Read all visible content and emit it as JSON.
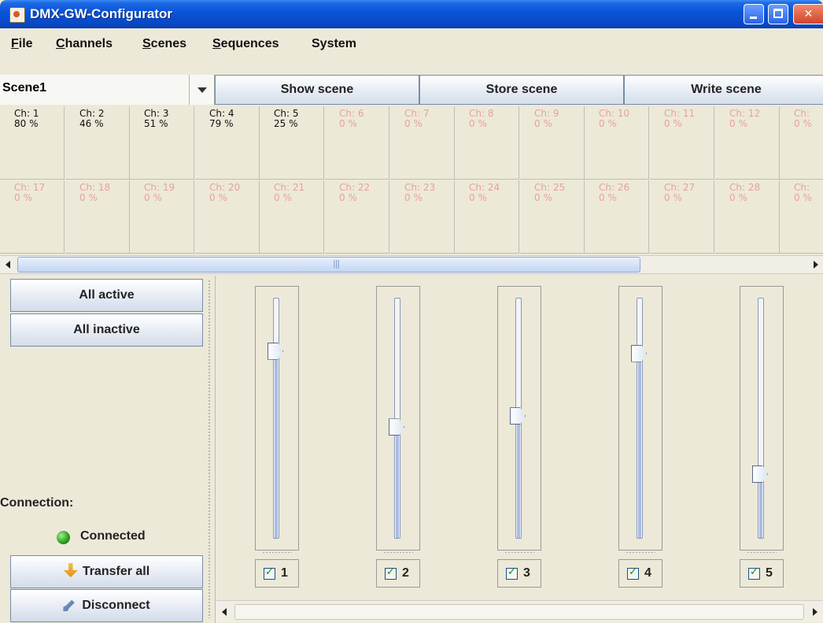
{
  "window": {
    "title": "DMX-GW-Configurator"
  },
  "menu": [
    {
      "label": "File",
      "mnemonic": "F",
      "rest": "ile"
    },
    {
      "label": "Channels",
      "mnemonic": "C",
      "rest": "hannels"
    },
    {
      "label": "Scenes",
      "mnemonic": "S",
      "rest": "cenes"
    },
    {
      "label": "Sequences",
      "mnemonic": "S",
      "rest": "equences"
    },
    {
      "label": "System",
      "mnemonic": "",
      "rest": "System"
    }
  ],
  "scene": {
    "selected": "Scene1",
    "show_label": "Show scene",
    "store_label": "Store scene",
    "write_label": "Write scene"
  },
  "channels_row1": [
    {
      "ch": "Ch: 1",
      "val": "80 %",
      "active": true
    },
    {
      "ch": "Ch: 2",
      "val": "46 %",
      "active": true
    },
    {
      "ch": "Ch: 3",
      "val": "51 %",
      "active": true
    },
    {
      "ch": "Ch: 4",
      "val": "79 %",
      "active": true
    },
    {
      "ch": "Ch: 5",
      "val": "25 %",
      "active": true
    },
    {
      "ch": "Ch: 6",
      "val": "0 %",
      "active": false
    },
    {
      "ch": "Ch: 7",
      "val": "0 %",
      "active": false
    },
    {
      "ch": "Ch: 8",
      "val": "0 %",
      "active": false
    },
    {
      "ch": "Ch: 9",
      "val": "0 %",
      "active": false
    },
    {
      "ch": "Ch: 10",
      "val": "0 %",
      "active": false
    },
    {
      "ch": "Ch: 11",
      "val": "0 %",
      "active": false
    },
    {
      "ch": "Ch: 12",
      "val": "0 %",
      "active": false
    },
    {
      "ch": "Ch:",
      "val": "0 %",
      "active": false
    }
  ],
  "channels_row2": [
    {
      "ch": "Ch: 17",
      "val": "0 %",
      "active": false
    },
    {
      "ch": "Ch: 18",
      "val": "0 %",
      "active": false
    },
    {
      "ch": "Ch: 19",
      "val": "0 %",
      "active": false
    },
    {
      "ch": "Ch: 20",
      "val": "0 %",
      "active": false
    },
    {
      "ch": "Ch: 21",
      "val": "0 %",
      "active": false
    },
    {
      "ch": "Ch: 22",
      "val": "0 %",
      "active": false
    },
    {
      "ch": "Ch: 23",
      "val": "0 %",
      "active": false
    },
    {
      "ch": "Ch: 24",
      "val": "0 %",
      "active": false
    },
    {
      "ch": "Ch: 25",
      "val": "0 %",
      "active": false
    },
    {
      "ch": "Ch: 26",
      "val": "0 %",
      "active": false
    },
    {
      "ch": "Ch: 27",
      "val": "0 %",
      "active": false
    },
    {
      "ch": "Ch: 28",
      "val": "0 %",
      "active": false
    },
    {
      "ch": "Ch:",
      "val": "0 %",
      "active": false
    }
  ],
  "left": {
    "all_active": "All active",
    "all_inactive": "All inactive",
    "connection_label": "Connection:",
    "connection_status": "Connected",
    "transfer_all": "Transfer all",
    "disconnect": "Disconnect"
  },
  "faders": [
    {
      "label": "1",
      "level": 0.8,
      "checked": true
    },
    {
      "label": "2",
      "level": 0.46,
      "checked": true
    },
    {
      "label": "3",
      "level": 0.51,
      "checked": true
    },
    {
      "label": "4",
      "level": 0.79,
      "checked": true
    },
    {
      "label": "5",
      "level": 0.25,
      "checked": true
    }
  ],
  "colors": {
    "title_blue": "#0848C6",
    "inactive_text": "#E8A0A6",
    "close_red": "#D2452A"
  }
}
